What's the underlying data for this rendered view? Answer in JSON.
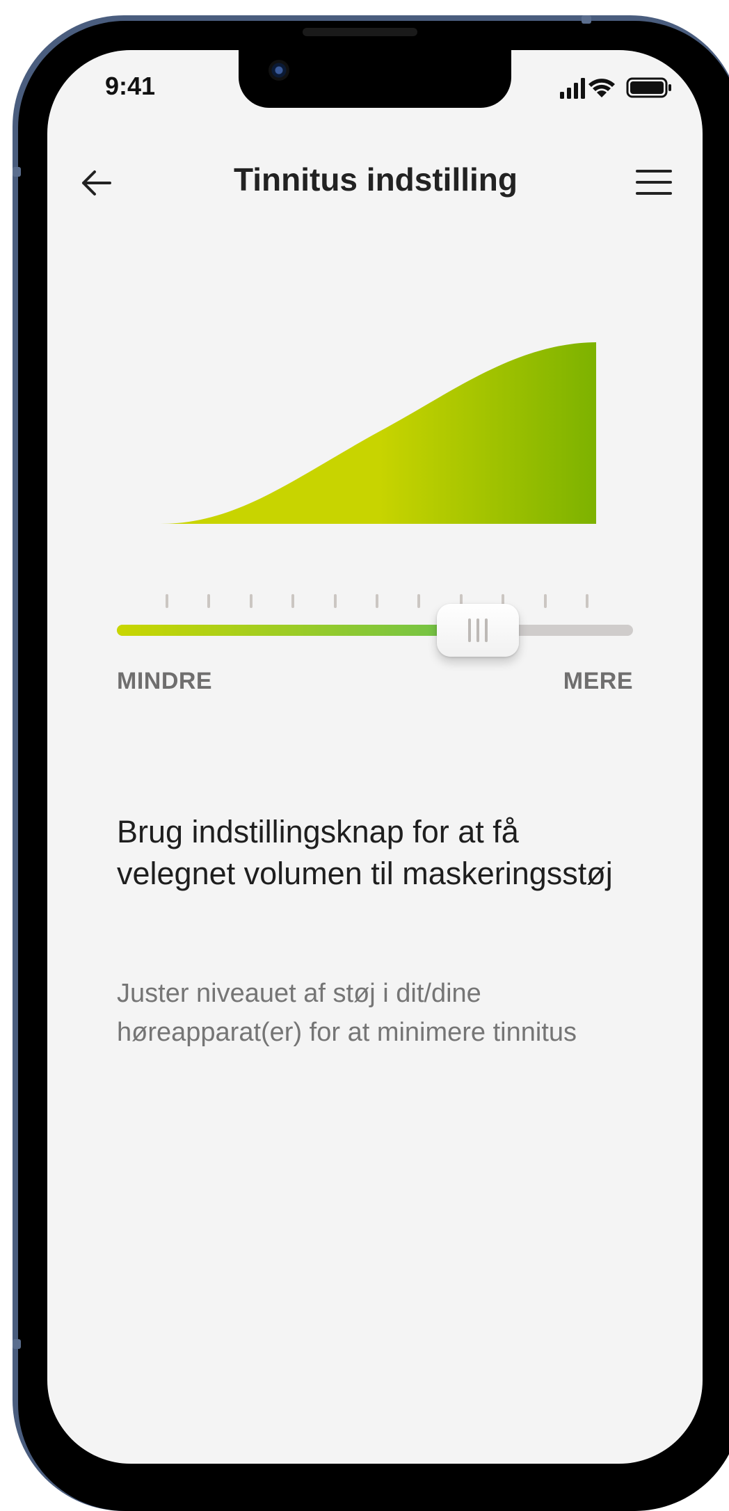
{
  "status_bar": {
    "time": "9:41"
  },
  "header": {
    "title": "Tinnitus indstilling",
    "back_icon": "arrow-left-icon",
    "menu_icon": "hamburger-menu-icon"
  },
  "slider": {
    "min_label": "MINDRE",
    "max_label": "MERE",
    "tick_count": 11,
    "value_fraction": 0.7,
    "colors": {
      "fill_start": "#c9d600",
      "fill_end": "#6fc24a",
      "track": "#cfcccb",
      "curve_start": "#c8d400",
      "curve_end": "#7db200"
    }
  },
  "content": {
    "heading": "Brug indstillingsknap for at få velegnet volumen til maskeringsstøj",
    "description": "Juster niveauet af støj i dit/dine høreapparat(er) for at minimere tinnitus"
  }
}
